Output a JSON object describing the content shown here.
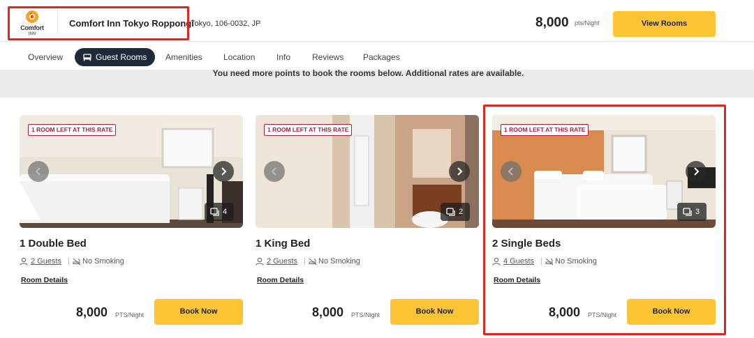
{
  "header": {
    "logo_text": "Comfort",
    "logo_sub": "INN",
    "hotel_name": "Comfort Inn Tokyo Roppongi",
    "address": "Tokyo, 106-0032, JP",
    "price": "8,000",
    "price_unit": "pts/Night",
    "view_rooms_label": "View Rooms"
  },
  "tabs": [
    {
      "label": "Overview"
    },
    {
      "label": "Guest Rooms",
      "active": true
    },
    {
      "label": "Amenities"
    },
    {
      "label": "Location"
    },
    {
      "label": "Info"
    },
    {
      "label": "Reviews"
    },
    {
      "label": "Packages"
    }
  ],
  "notice": "You need more points to book the rooms below. Additional rates are available.",
  "rooms": [
    {
      "badge": "1 ROOM LEFT AT THIS RATE",
      "photo_count": "4",
      "title": "1 Double Bed",
      "guests": "2 Guests",
      "smoking": "No Smoking",
      "details": "Room Details",
      "price": "8,000",
      "price_unit": "PTS/Night",
      "book_label": "Book Now"
    },
    {
      "badge": "1 ROOM LEFT AT THIS RATE",
      "photo_count": "2",
      "title": "1 King Bed",
      "guests": "2 Guests",
      "smoking": "No Smoking",
      "details": "Room Details",
      "price": "8,000",
      "price_unit": "PTS/Night",
      "book_label": "Book Now"
    },
    {
      "badge": "1 ROOM LEFT AT THIS RATE",
      "photo_count": "3",
      "title": "2 Single Beds",
      "guests": "4 Guests",
      "smoking": "No Smoking",
      "details": "Room Details",
      "price": "8,000",
      "price_unit": "PTS/Night",
      "book_label": "Book Now"
    }
  ],
  "colors": {
    "accent_button": "#fdc533",
    "active_tab": "#1e2a3a",
    "highlight_box": "#e0251f",
    "badge": "#b31b3a"
  }
}
